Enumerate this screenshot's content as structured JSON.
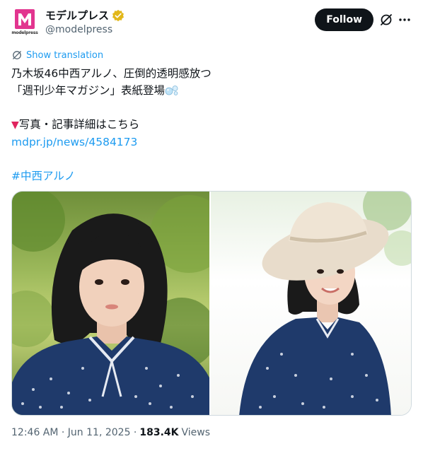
{
  "author": {
    "display_name": "モデルプレス",
    "handle": "@modelpress",
    "logo_word": "modelpress",
    "verified_color": "#e2b719",
    "brand_color": "#e2358f"
  },
  "actions": {
    "follow_label": "Follow",
    "grok_icon": "grok-icon",
    "more_icon": "more-icon"
  },
  "translate_label": "Show translation",
  "tweet": {
    "line1": "乃木坂46中西アルノ、圧倒的透明感放つ",
    "line2": "「週刊少年マガジン」表紙登場",
    "line3_marker": "▼",
    "line3_text": "写真・記事詳細はこちら",
    "link": "mdpr.jp/news/4584173",
    "hashtag": "#中西アルノ"
  },
  "media": {
    "photos": [
      {
        "description_icon": "photo-portrait-garden"
      },
      {
        "description_icon": "photo-portrait-hat"
      }
    ]
  },
  "meta": {
    "time": "12:46 AM · Jun 11, 2025 ·",
    "views_count": "183.4K",
    "views_label": "Views"
  },
  "colors": {
    "link": "#1d9bf0",
    "text": "#0f1419",
    "secondary": "#536471"
  }
}
